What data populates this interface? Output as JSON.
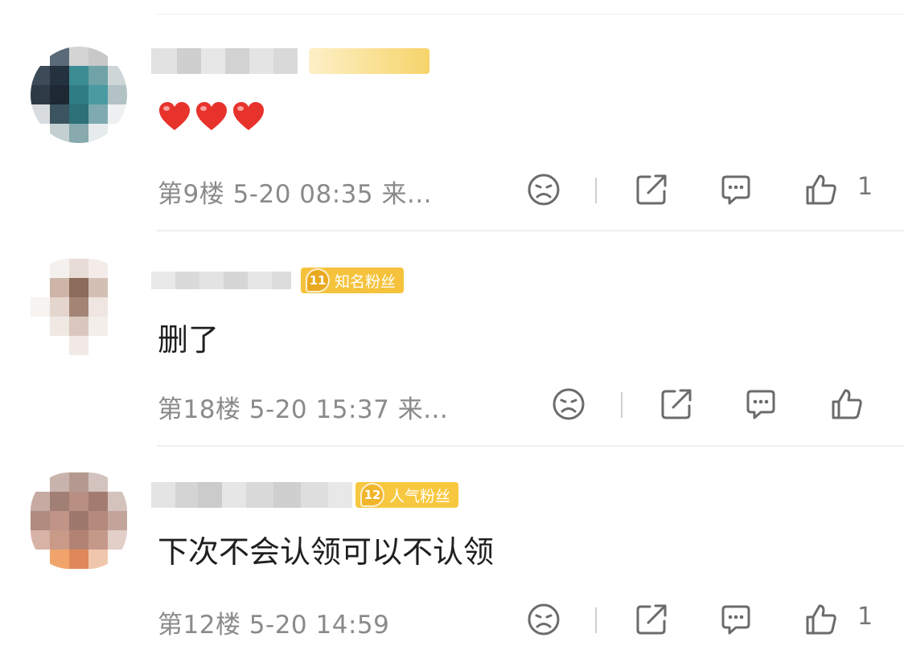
{
  "comments": [
    {
      "content_type": "emoji-hearts",
      "content": "❤️❤️❤️",
      "badge": {
        "text": "",
        "level": "",
        "color": "#f8d25a"
      },
      "meta": "第9楼 5-20 08:35 来...",
      "like_count": "1"
    },
    {
      "content_type": "text",
      "content": "删了",
      "badge": {
        "text": "知名粉丝",
        "level": "11",
        "color": "#f5c23c"
      },
      "meta": "第18楼 5-20 15:37 来...",
      "like_count": ""
    },
    {
      "content_type": "text",
      "content": "下次不会认领可以不认领",
      "badge": {
        "text": "人气粉丝",
        "level": "12",
        "color": "#f7c83f"
      },
      "meta": "第12楼 5-20 14:59",
      "like_count": "1"
    }
  ],
  "icons": {
    "dislike": "sad-face-icon",
    "share": "share-icon",
    "reply": "comment-icon",
    "like": "thumbs-up-icon"
  },
  "colors": {
    "icon": "#6b6b6b",
    "meta_text": "#8a8a8a",
    "heart": "#e8322c"
  }
}
